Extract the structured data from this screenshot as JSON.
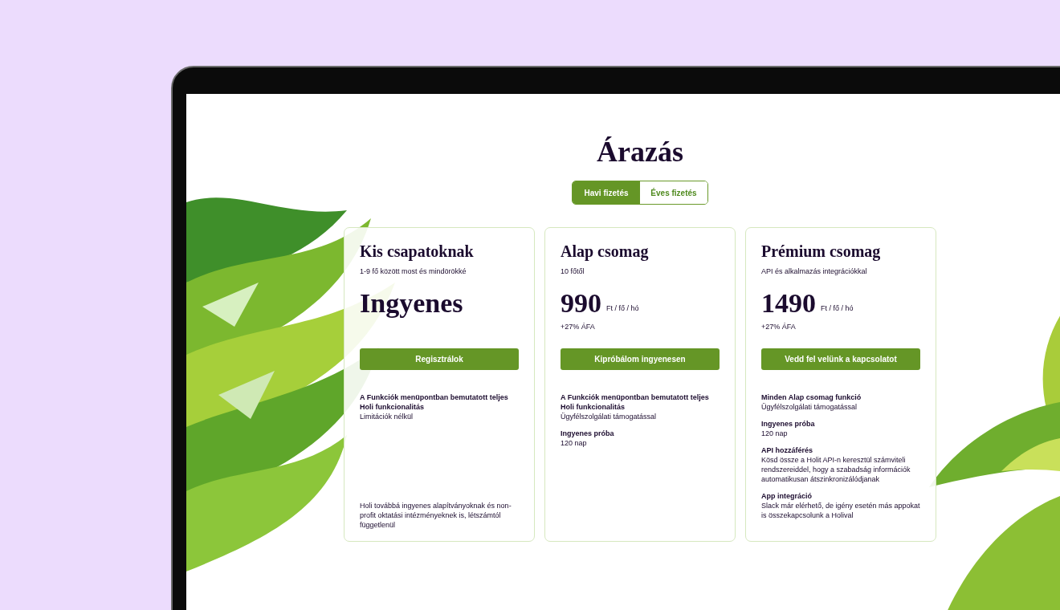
{
  "heading": "Árazás",
  "billing_tabs": [
    {
      "label": "Havi fizetés",
      "selected": true
    },
    {
      "label": "Éves fizetés",
      "selected": false
    }
  ],
  "plans": [
    {
      "name": "Kis csapatoknak",
      "subtitle": "1-9 fő között most és mindörökké",
      "price": "Ingyenes",
      "button": "Regisztrálok",
      "features": [
        {
          "title": "A Funkciók menüpontban bemutatott teljes Holi funkcionalitás",
          "detail": "Limitációk nélkül"
        }
      ],
      "note": "Holi továbbá ingyenes alapítványoknak és non-profit oktatási intézményeknek is, létszámtól függetlenül"
    },
    {
      "name": "Alap csomag",
      "subtitle": "10 főtől",
      "price": "990",
      "unit": "Ft / fő / hó",
      "vat": "+27% ÁFA",
      "button": "Kipróbálom ingyenesen",
      "features": [
        {
          "title": "A Funkciók menüpontban bemutatott teljes Holi funkcionalitás",
          "detail": "Ügyfélszolgálati támogatással"
        },
        {
          "title": "Ingyenes próba",
          "detail": "120 nap"
        }
      ]
    },
    {
      "name": "Prémium csomag",
      "subtitle": "API és alkalmazás integrációkkal",
      "price": "1490",
      "unit": "Ft / fő / hó",
      "vat": "+27% ÁFA",
      "button": "Vedd fel velünk a kapcsolatot",
      "features": [
        {
          "title": "Minden Alap csomag funkció",
          "detail": "Ügyfélszolgálati támogatással"
        },
        {
          "title": "Ingyenes próba",
          "detail": "120 nap"
        },
        {
          "title": "API hozzáférés",
          "detail": "Kösd össze a Holit API-n keresztül számviteli rendszereiddel, hogy a szabadság információk automatikusan átszinkronizálódjanak"
        },
        {
          "title": "App integráció",
          "detail": "Slack már elérhető, de igény esetén más appokat is összekapcsolunk a Holival"
        }
      ]
    }
  ]
}
